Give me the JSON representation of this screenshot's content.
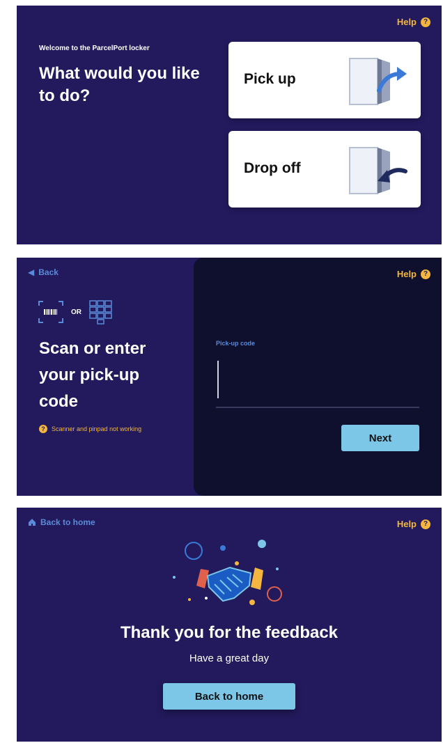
{
  "screen1": {
    "help_label": "Help",
    "welcome": "Welcome to the ParcelPort locker",
    "title": "What would you like to do?",
    "options": [
      {
        "label": "Pick up",
        "icon": "door-open-arrow-out-icon"
      },
      {
        "label": "Drop off",
        "icon": "door-open-arrow-in-icon"
      }
    ]
  },
  "screen2": {
    "back_label": "Back",
    "help_label": "Help",
    "or_text": "OR",
    "title": "Scan or enter your pick-up code",
    "help_text": "Scanner and pinpad not working",
    "code_label": "Pick-up code",
    "code_value": "",
    "next_label": "Next"
  },
  "screen3": {
    "back_home_label": "Back to home",
    "help_label": "Help",
    "title": "Thank you for the feedback",
    "subtitle": "Have a great day",
    "button_label": "Back to home"
  },
  "colors": {
    "background": "#221a5c",
    "panel_dark": "#0f0f2e",
    "accent_yellow": "#f4b63f",
    "accent_blue": "#7cc7e8",
    "link_blue": "#5b8bd8"
  }
}
